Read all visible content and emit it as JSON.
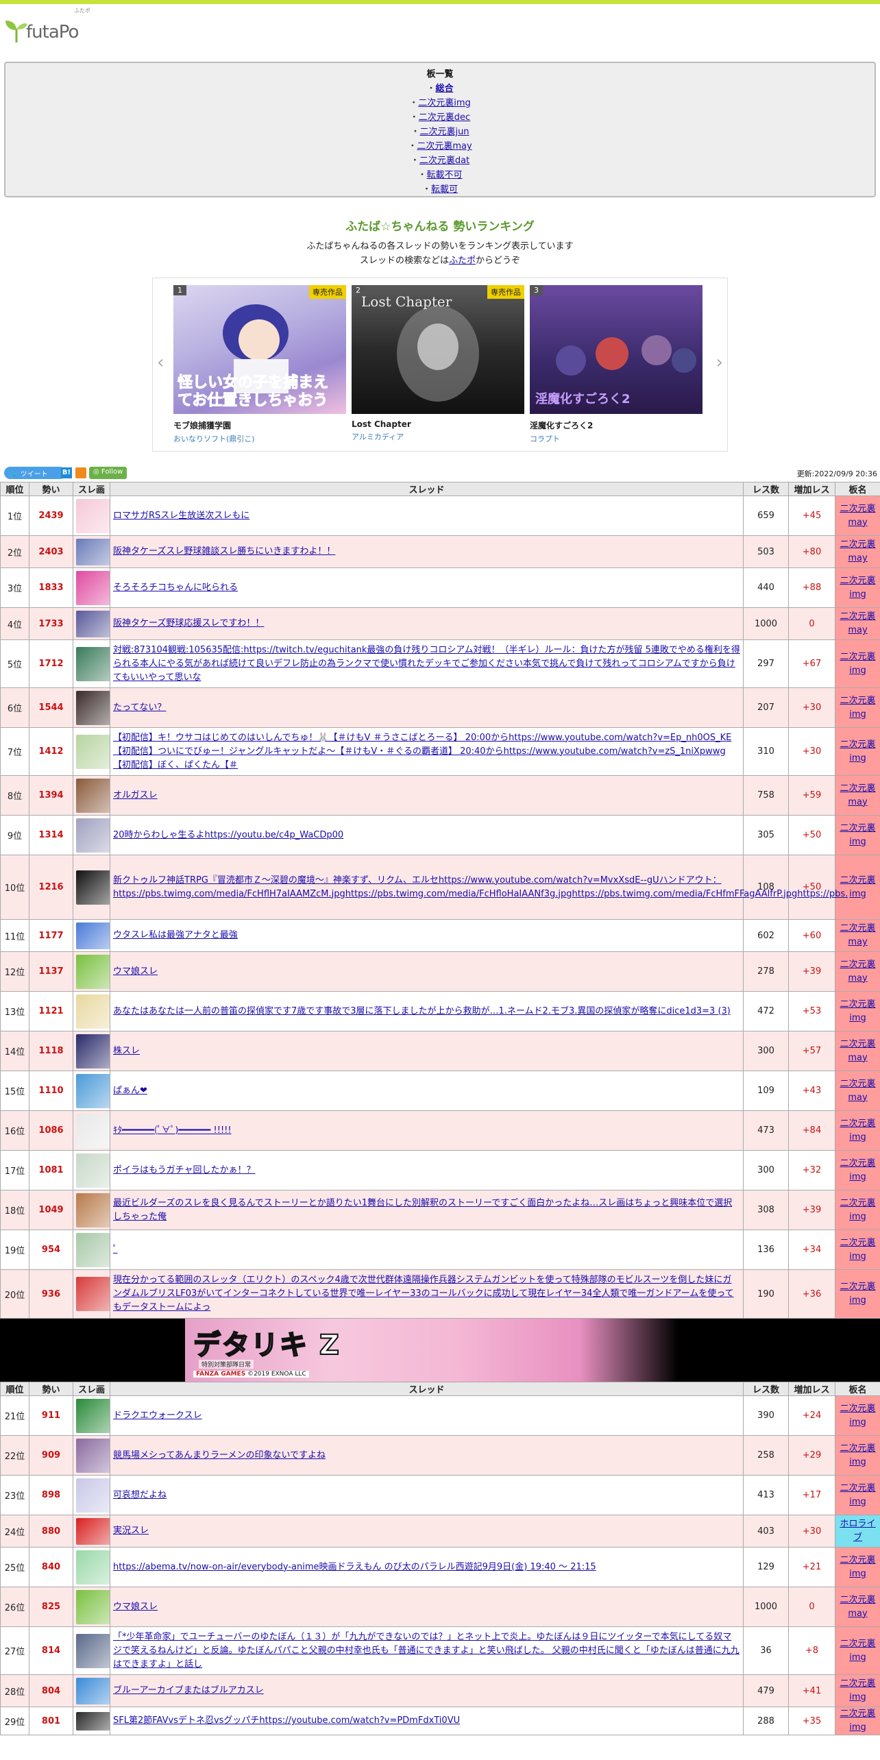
{
  "site": {
    "logo_text": "futaPo",
    "logo_sub": "ふたポ"
  },
  "boards": {
    "title": "板一覧",
    "items": [
      {
        "label": "総合",
        "current": true
      },
      {
        "label": "二次元裏img"
      },
      {
        "label": "二次元裏dec"
      },
      {
        "label": "二次元裏jun"
      },
      {
        "label": "二次元裏may"
      },
      {
        "label": "二次元裏dat"
      },
      {
        "label": "転載不可"
      },
      {
        "label": "転載可"
      }
    ]
  },
  "intro": {
    "title": "ふたば☆ちゃんねる 勢いランキング",
    "line1": "ふたばちゃんねるの各スレッドの勢いをランキング表示しています",
    "line2_prefix": "スレッドの検索などは",
    "line2_link": "ふたポ",
    "line2_suffix": "からどうぞ"
  },
  "carousel": {
    "exclusive_label": "専売作品",
    "items": [
      {
        "rank": "1",
        "title": "モブ娘捕獲学園",
        "maker": "おいなりソフト(鼎引こ)",
        "exclusive": true,
        "cover_text": "怪しい女の子を捕まえてお仕置きしちゃおう"
      },
      {
        "rank": "2",
        "title": "Lost Chapter",
        "maker": "アルミカディア",
        "exclusive": true,
        "cover_text": "Lost Chapter"
      },
      {
        "rank": "3",
        "title": "淫魔化すごろく2",
        "maker": "コラプト",
        "exclusive": false,
        "cover_text": "淫魔化すごろく2"
      }
    ]
  },
  "social": {
    "tweet": "ツイート",
    "hatena": "B!",
    "follow": "Follow",
    "updated": "更新:2022/09/9 20:36"
  },
  "table_headers": {
    "rank": "順位",
    "ikioi": "勢い",
    "thumb": "スレ画",
    "thread": "スレッド",
    "res": "レス数",
    "inc": "増加レス",
    "board": "板名"
  },
  "rows1": [
    {
      "rank": "1位",
      "ikioi": "2439",
      "thread": "ロマサガRSスレ生放送次スレもに",
      "res": "659",
      "inc": "+45",
      "board1": "二次元裏",
      "board2": "may",
      "color": "#f6c8d8"
    },
    {
      "rank": "2位",
      "ikioi": "2403",
      "thread": "阪神タケーズスレ野球雑談スレ勝ちにいきますわよ！！",
      "res": "503",
      "inc": "+80",
      "board1": "二次元裏",
      "board2": "may",
      "color": "#6a7ab8"
    },
    {
      "rank": "3位",
      "ikioi": "1833",
      "thread": "そろそろチコちゃんに叱られる",
      "res": "440",
      "inc": "+88",
      "board1": "二次元裏",
      "board2": "img",
      "color": "#e04aa0"
    },
    {
      "rank": "4位",
      "ikioi": "1733",
      "thread": "阪神タケーズ野球応援スレですわ！！",
      "res": "1000",
      "inc": "0",
      "board1": "二次元裏",
      "board2": "may",
      "color": "#5a5a9a"
    },
    {
      "rank": "5位",
      "ikioi": "1712",
      "thread": "対戦:873104観戦:105635配信:https://twitch.tv/eguchitank最強の負け残りコロシアム対戦！（半ギレ）ルール：負けた方が残留 5連敗でやめる権利を得られる本人にやる気があれば続けて良いデフレ防止の為ランクマで使い慣れたデッキでご参加ください本気で挑んで負けて残れってコロシアムですから負けてもいいやって思いな",
      "res": "297",
      "inc": "+67",
      "board1": "二次元裏",
      "board2": "img",
      "color": "#3a7a5a"
    },
    {
      "rank": "6位",
      "ikioi": "1544",
      "thread": "たってない？",
      "res": "207",
      "inc": "+30",
      "board1": "二次元裏",
      "board2": "img",
      "color": "#3a2a2a"
    },
    {
      "rank": "7位",
      "ikioi": "1412",
      "thread": "【初配信】キ！ウサコはじめてのはいしんでちゅ！🐰【＃けもV ＃うさこばとろーる】 20:00からhttps://www.youtube.com/watch?v=Ep_nh0OS_KE【初配信】ついにでびゅー！ジャングルキャットだよ〜【＃けもV・＃ぐるの覇者道】 20:40からhttps://www.youtube.com/watch?v=zS_1niXpwwg【初配信】ぼく、ぱくたん【＃",
      "res": "310",
      "inc": "+30",
      "board1": "二次元裏",
      "board2": "img",
      "color": "#b8d4a0"
    },
    {
      "rank": "8位",
      "ikioi": "1394",
      "thread": "オルガスレ",
      "res": "758",
      "inc": "+59",
      "board1": "二次元裏",
      "board2": "may",
      "color": "#8a5a3a"
    },
    {
      "rank": "9位",
      "ikioi": "1314",
      "thread": "20時からわしゃ生るよhttps://youtu.be/c4p_WaCDp00",
      "res": "305",
      "inc": "+50",
      "board1": "二次元裏",
      "board2": "img",
      "color": "#a0a0c0"
    },
    {
      "rank": "10位",
      "ikioi": "1216",
      "thread": "新クトゥルフ神話TRPG『冒涜都市Ｚ〜深碧の魔境〜』神楽すず、リクム、エルセhttps://www.youtube.com/watch?v=MvxXsdE--gUハンドアウト：https://pbs.twimg.com/media/FcHflH7aIAAMZcM.jpghttps://pbs.twimg.com/media/FcHfloHaIAANf3g.jpghttps://pbs.twimg.com/media/FcHfmFFagAAlfrP.jpghttps://pbs.",
      "res": "108",
      "inc": "+50",
      "board1": "二次元裏",
      "board2": "img",
      "color": "#111111"
    },
    {
      "rank": "11位",
      "ikioi": "1177",
      "thread": "ウタスレ私は最強アナタと最強",
      "res": "602",
      "inc": "+60",
      "board1": "二次元裏",
      "board2": "may",
      "color": "#4a7ad8"
    },
    {
      "rank": "12位",
      "ikioi": "1137",
      "thread": "ウマ娘スレ",
      "res": "278",
      "inc": "+39",
      "board1": "二次元裏",
      "board2": "may",
      "color": "#7ac040"
    },
    {
      "rank": "13位",
      "ikioi": "1121",
      "thread": "あなたはあなたは一人前の普笛の探偵家です7歳です事故で3層に落下しましたが上から救助が…1.ネームド2.モブ3.異国の探偵家が略奪にdice1d3=3 (3)",
      "res": "472",
      "inc": "+53",
      "board1": "二次元裏",
      "board2": "img",
      "color": "#e8d8a0"
    },
    {
      "rank": "14位",
      "ikioi": "1118",
      "thread": "株スレ",
      "res": "300",
      "inc": "+57",
      "board1": "二次元裏",
      "board2": "may",
      "color": "#2a2a6a"
    },
    {
      "rank": "15位",
      "ikioi": "1110",
      "thread": "ぱぁん❤",
      "res": "109",
      "inc": "+43",
      "board1": "二次元裏",
      "board2": "may",
      "color": "#4a9ad8"
    },
    {
      "rank": "16位",
      "ikioi": "1086",
      "thread": "ｷﾀ━━━━━━(ﾟ∀ﾟ)━━━━━━ !!!!!",
      "res": "473",
      "inc": "+84",
      "board1": "二次元裏",
      "board2": "img",
      "color": "#e8e8e8"
    },
    {
      "rank": "17位",
      "ikioi": "1081",
      "thread": "ポイラはもうガチャ回したかぁ！？",
      "res": "300",
      "inc": "+32",
      "board1": "二次元裏",
      "board2": "img",
      "color": "#c8d8c8"
    },
    {
      "rank": "18位",
      "ikioi": "1049",
      "thread": "最近ビルダーズのスレを良く見るんでストーリーとか語りたい1舞台にした別解釈のストーリーですごく面白かったよね…スレ画はちょっと興味本位で選択しちゃった俺",
      "res": "308",
      "inc": "+39",
      "board1": "二次元裏",
      "board2": "img",
      "color": "#b87a4a"
    },
    {
      "rank": "19位",
      "ikioi": "954",
      "thread": "ﾟ",
      "res": "136",
      "inc": "+34",
      "board1": "二次元裏",
      "board2": "img",
      "color": "#a8c8a8"
    },
    {
      "rank": "20位",
      "ikioi": "936",
      "thread": "現在分かってる範囲のスレッタ（エリクト）のスペック4歳で次世代群体遠隔操作兵器システムガンビットを使って特殊部隊のモビルスーツを倒した妹にガンダムルブリスLF03がいてインターコネクトしている世界で唯一レイヤー33のコールバックに成功して現在レイヤー34全人類で唯一ガンドアームを使ってもデータストームによっ",
      "res": "190",
      "inc": "+36",
      "board1": "二次元裏",
      "board2": "img",
      "color": "#d83a3a"
    }
  ],
  "banner": {
    "title": "デタリキ Z",
    "subtitle": "特別対策部隊日常",
    "copyright_brand": "FANZA GAMES",
    "copyright": "©2019 EXNOA LLC"
  },
  "rows2": [
    {
      "rank": "21位",
      "ikioi": "911",
      "thread": "ドラクエウォークスレ",
      "res": "390",
      "inc": "+24",
      "board1": "二次元裏",
      "board2": "img",
      "color": "#2a8a3a"
    },
    {
      "rank": "22位",
      "ikioi": "909",
      "thread": "競馬場メシってあんまりラーメンの印象ないですよね",
      "res": "258",
      "inc": "+29",
      "board1": "二次元裏",
      "board2": "img",
      "color": "#8a6aa0"
    },
    {
      "rank": "23位",
      "ikioi": "898",
      "thread": "可哀想だよね",
      "res": "413",
      "inc": "+17",
      "board1": "二次元裏",
      "board2": "img",
      "color": "#c8c8e8"
    },
    {
      "rank": "24位",
      "ikioi": "880",
      "thread": "実況スレ",
      "res": "403",
      "inc": "+30",
      "board1": "ホロライ",
      "board2": "ブ",
      "color": "#d82020",
      "holo": true
    },
    {
      "rank": "25位",
      "ikioi": "840",
      "thread": "https://abema.tv/now-on-air/everybody-anime映画ドラえもん のび太のパラレル西遊記9月9日(金) 19:40 〜 21:15",
      "res": "129",
      "inc": "+21",
      "board1": "二次元裏",
      "board2": "img",
      "color": "#9ad8a8"
    },
    {
      "rank": "26位",
      "ikioi": "825",
      "thread": "ウマ娘スレ",
      "res": "1000",
      "inc": "0",
      "board1": "二次元裏",
      "board2": "may",
      "color": "#7ac040"
    },
    {
      "rank": "27位",
      "ikioi": "814",
      "thread": "「*少年革命家」でユーチューバーのゆたぼん（１３）が「九九ができないのでは？」とネット上で炎上。ゆたぼんは９日にツイッターで本気にしてる奴マジで笑えるねんけど」と反論。ゆたぼんパパこと父親の中村幸也氏も「普通にできますよ」と笑い飛ばした。 父親の中村氏に聞くと「ゆたぼんは普通に九九はできますよ」と話し",
      "res": "36",
      "inc": "+8",
      "board1": "二次元裏",
      "board2": "img",
      "color": "#5a6a8a"
    },
    {
      "rank": "28位",
      "ikioi": "804",
      "thread": "ブルーアーカイブまたはブルアカスレ",
      "res": "479",
      "inc": "+41",
      "board1": "二次元裏",
      "board2": "img",
      "color": "#3a8ad8"
    },
    {
      "rank": "29位",
      "ikioi": "801",
      "thread": "SFL第2節FAVvsデトネ忍vsグッパチhttps://youtube.com/watch?v=PDmFdxTi0VU",
      "res": "288",
      "inc": "+35",
      "board1": "二次元裏",
      "board2": "img",
      "color": "#2a2a2a"
    }
  ]
}
